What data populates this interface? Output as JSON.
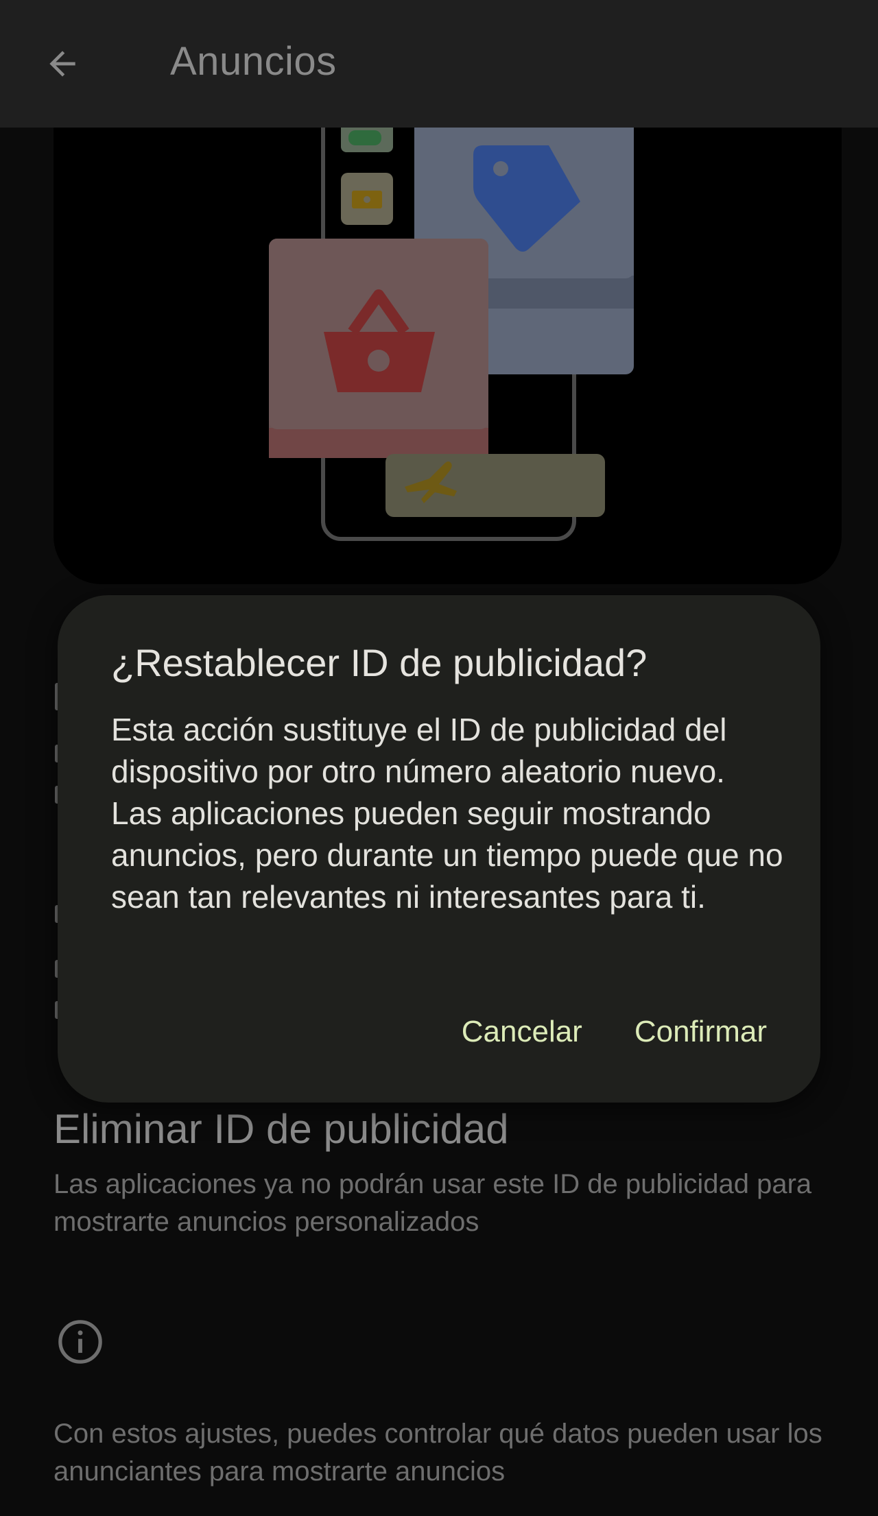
{
  "app_bar": {
    "title": "Anuncios",
    "back_icon": "arrow-back-icon"
  },
  "hero": {
    "icons": [
      "gamepad-icon",
      "ticket-icon",
      "price-tag-icon",
      "shopping-basket-icon",
      "airplane-icon"
    ],
    "colors": {
      "tag_card": "#7788a8",
      "tag": "#2f4d8f",
      "basket_card": "#8e6969",
      "basket": "#8a2f2f",
      "plane_card": "#6b6a5a",
      "plane": "#7d6210"
    }
  },
  "settings": {
    "delete_id_title": "Eliminar ID de publicidad",
    "delete_id_summary": "Las aplicaciones ya no podrán usar este ID de publicidad para mostrarte anuncios personalizados",
    "info_icon": "info-icon",
    "footer_text": "Con estos ajustes, puedes controlar qué datos pueden usar los anunciantes para mostrarte anuncios"
  },
  "dialog": {
    "title": "¿Restablecer ID de publicidad?",
    "body": "Esta acción sustituye el ID de publicidad del dispositivo por otro número aleatorio nuevo. Las aplicaciones pueden seguir mostrando anuncios, pero durante un tiempo puede que no sean tan relevantes ni interesantes para ti.",
    "cancel_label": "Cancelar",
    "confirm_label": "Confirmar",
    "accent_color": "#dcebb8"
  }
}
